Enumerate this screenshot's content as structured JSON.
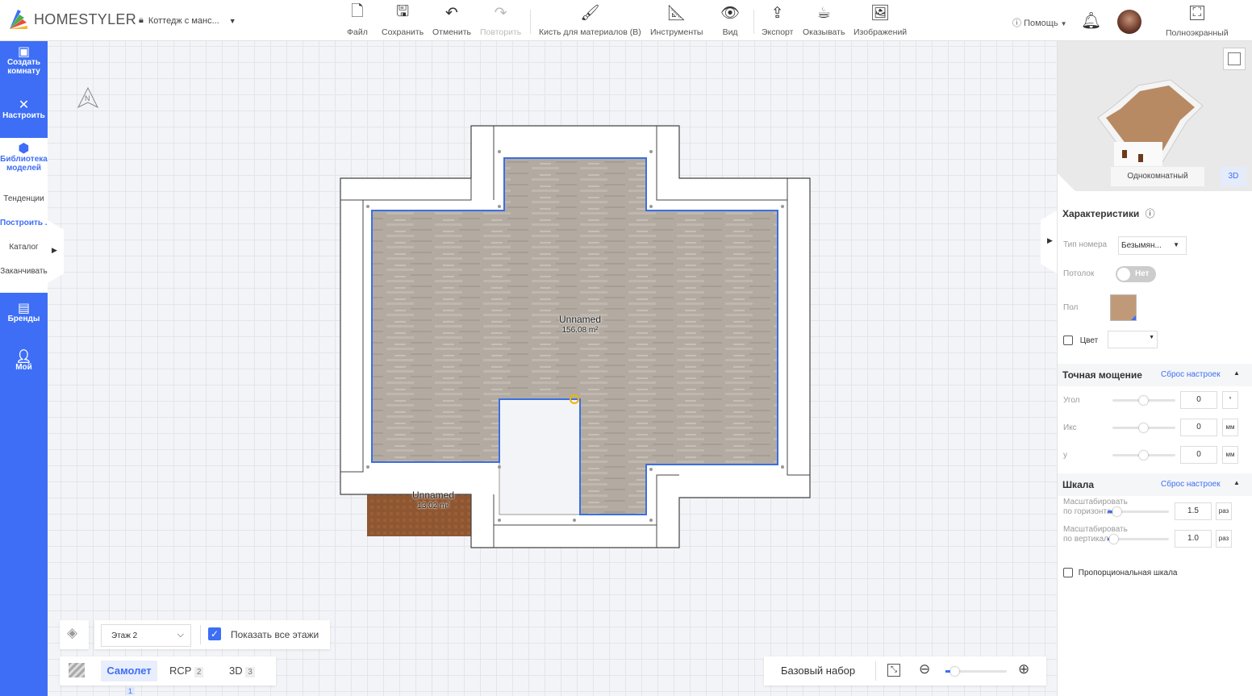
{
  "app": {
    "brand": "HOMESTYLER",
    "document_title": "Коттедж с манс..."
  },
  "toolbar": {
    "items": [
      {
        "label": "Файл",
        "icon": "file-icon"
      },
      {
        "label": "Сохранить",
        "icon": "save-icon"
      },
      {
        "label": "Отменить",
        "icon": "undo-icon"
      },
      {
        "label": "Повторить",
        "icon": "redo-icon",
        "disabled": true
      },
      {
        "label": "Кисть для материалов (B)",
        "icon": "brush-icon"
      },
      {
        "label": "Инструменты",
        "icon": "tools-icon"
      },
      {
        "label": "Вид",
        "icon": "eye-icon"
      },
      {
        "label": "Экспорт",
        "icon": "export-icon"
      },
      {
        "label": "Оказывать",
        "icon": "teapot-icon"
      },
      {
        "label": "Изображений",
        "icon": "images-icon"
      }
    ]
  },
  "header_right": {
    "help": "Помощь",
    "fullscreen": "Полноэкранный"
  },
  "sidebar": {
    "items": [
      {
        "label": "Создать комнату"
      },
      {
        "label": "Настроить"
      },
      {
        "label": "Библиотека моделей"
      },
      {
        "label": "Бренды"
      },
      {
        "label": "Мой"
      }
    ],
    "sub_items": [
      "Тенденции",
      "Построить ...",
      "Каталог",
      "Заканчивать"
    ]
  },
  "plan": {
    "rooms": [
      {
        "name": "Unnamed",
        "area": "156.08 m²"
      },
      {
        "name": "Unnamed",
        "area": "13.02 m²"
      }
    ],
    "compass": "N"
  },
  "floor_controls": {
    "floor": "Этаж 2",
    "show_all_label": "Показать все этажи",
    "show_all_checked": true
  },
  "view_tabs": [
    {
      "label": "Самолет",
      "shortcut": "1",
      "active": true
    },
    {
      "label": "RCP",
      "shortcut": "2"
    },
    {
      "label": "3D",
      "shortcut": "3"
    }
  ],
  "zoom_bar": {
    "preset": "Базовый набор",
    "zoom_level": 0.1
  },
  "preview": {
    "mode_label": "Однокомнатный",
    "view_btn": "3D"
  },
  "properties": {
    "title": "Характеристики",
    "room_type_label": "Тип номера",
    "room_type_value": "Безымян...",
    "ceiling_label": "Потолок",
    "ceiling_value": "Нет",
    "floor_label": "Пол",
    "color_label": "Цвет",
    "color_checked": false
  },
  "tiling": {
    "title": "Точная мощение",
    "reset": "Сброс настроек",
    "fields": [
      {
        "label": "Угол",
        "value": "0",
        "unit": "°"
      },
      {
        "label": "Икс",
        "value": "0",
        "unit": "мм"
      },
      {
        "label": "у",
        "value": "0",
        "unit": "мм"
      }
    ]
  },
  "scale": {
    "title": "Шкала",
    "reset": "Сброс настроек",
    "fields": [
      {
        "label": "Масштабировать по горизонтали",
        "value": "1.5",
        "unit": "раз"
      },
      {
        "label": "Масштабировать по вертикали",
        "value": "1.0",
        "unit": "раз"
      }
    ],
    "proportional_label": "Пропорциональная шкала",
    "proportional_checked": false
  },
  "colors": {
    "accent": "#3d6ef5",
    "room_outline": "#3a6fe0"
  }
}
